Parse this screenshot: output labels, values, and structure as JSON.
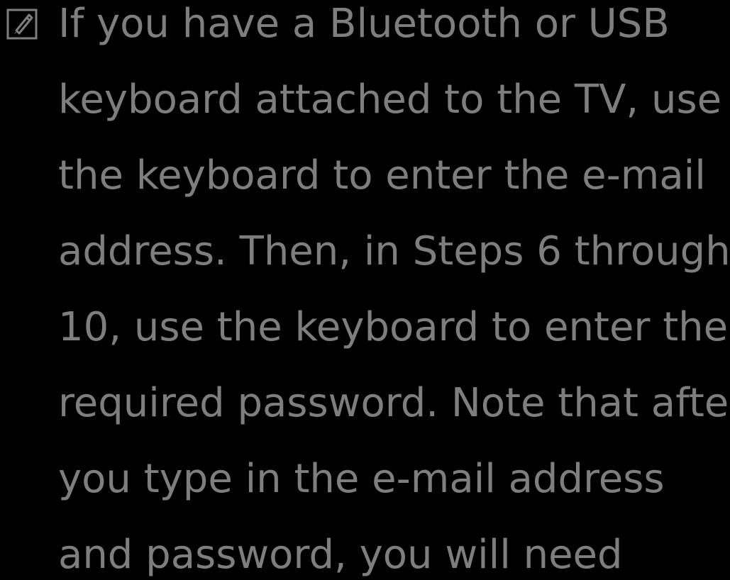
{
  "note": {
    "icon": "note-pencil-icon",
    "text_color": "#7e7e7e",
    "background": "#000000",
    "lines": [
      "If you have a Bluetooth or USB",
      "keyboard attached to the TV, use",
      "the keyboard to enter the e-mail",
      "address. Then, in Steps 6 through",
      "10, use the keyboard to enter the",
      "required password. Note that after",
      "you type in the e-mail address",
      "and password, you will need"
    ]
  }
}
